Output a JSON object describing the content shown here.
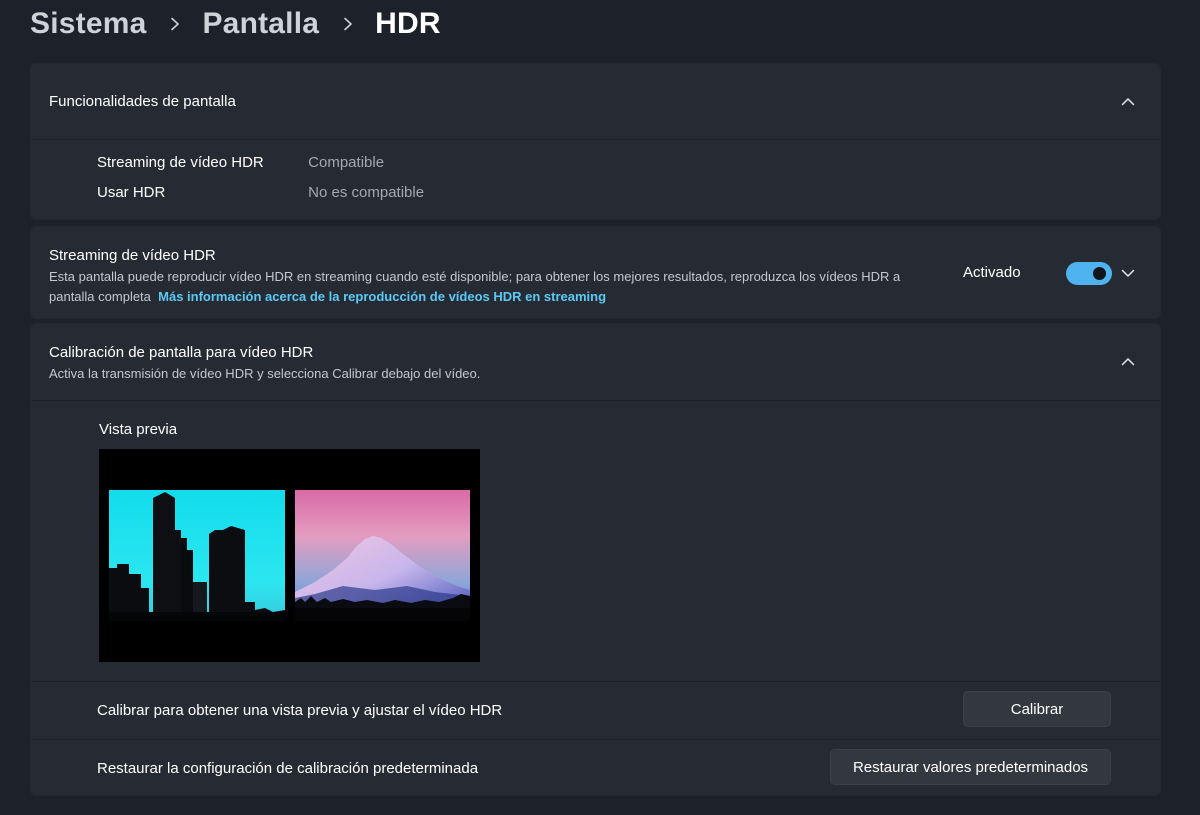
{
  "breadcrumb": {
    "items": [
      "Sistema",
      "Pantalla",
      "HDR"
    ]
  },
  "display_capabilities": {
    "title": "Funcionalidades de pantalla",
    "rows": [
      {
        "label": "Streaming de vídeo HDR",
        "value": "Compatible"
      },
      {
        "label": "Usar HDR",
        "value": "No es compatible"
      }
    ]
  },
  "hdr_streaming": {
    "title": "Streaming de vídeo HDR",
    "description": "Esta pantalla puede reproducir vídeo HDR en streaming cuando esté disponible; para obtener los mejores resultados, reproduzca los vídeos HDR a pantalla completa",
    "link": "Más información acerca de la reproducción de vídeos HDR en streaming",
    "toggle_label": "Activado",
    "toggle_on": true
  },
  "calibration": {
    "title": "Calibración de pantalla para vídeo HDR",
    "description": "Activa la transmisión de vídeo HDR y selecciona Calibrar debajo del vídeo.",
    "preview_label": "Vista previa",
    "calibrate_text": "Calibrar para obtener una vista previa y ajustar el vídeo HDR",
    "calibrate_button": "Calibrar",
    "restore_text": "Restaurar la configuración de calibración predeterminada",
    "restore_button": "Restaurar valores predeterminados"
  },
  "colors": {
    "accent": "#4fb3f0",
    "link": "#5bc9f5",
    "background": "#1d2129",
    "card": "#262b33"
  },
  "icons": {
    "separator": "chevron-right-icon",
    "collapse": "chevron-up-icon",
    "expand": "chevron-down-icon"
  }
}
